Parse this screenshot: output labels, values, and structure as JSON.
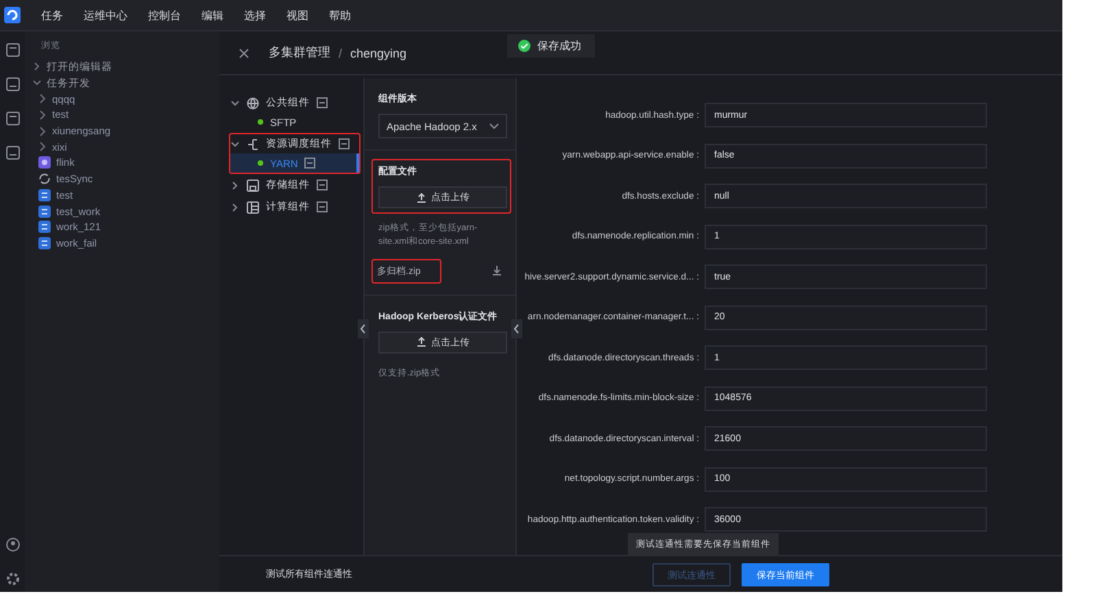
{
  "menu": [
    "任务",
    "运维中心",
    "控制台",
    "编辑",
    "选择",
    "视图",
    "帮助"
  ],
  "sidebar": {
    "heading": "浏览",
    "items": [
      {
        "label": "打开的编辑器",
        "expanded": false
      },
      {
        "label": "任务开发",
        "expanded": true,
        "children": [
          {
            "label": "qqqq",
            "kind": "folder"
          },
          {
            "label": "test",
            "kind": "folder"
          },
          {
            "label": "xiunengsang",
            "kind": "folder"
          },
          {
            "label": "xixi",
            "kind": "folder"
          },
          {
            "label": "flink",
            "kind": "flink"
          },
          {
            "label": "tesSync",
            "kind": "sync"
          },
          {
            "label": "test",
            "kind": "sql"
          },
          {
            "label": "test_work",
            "kind": "sql"
          },
          {
            "label": "work_121",
            "kind": "sql"
          },
          {
            "label": "work_fail",
            "kind": "sql"
          }
        ]
      }
    ]
  },
  "toast": {
    "text": "保存成功"
  },
  "breadcrumb": [
    "多集群管理",
    "chengying"
  ],
  "breadcrumb_separator": "/",
  "components": [
    {
      "label": "公共组件",
      "kind": "globe",
      "expanded": true,
      "children": [
        {
          "label": "SFTP",
          "selected": false
        }
      ]
    },
    {
      "label": "资源调度组件",
      "kind": "scheduler",
      "expanded": true,
      "highlighted": true,
      "children": [
        {
          "label": "YARN",
          "selected": true
        }
      ]
    },
    {
      "label": "存储组件",
      "kind": "storage",
      "expanded": false
    },
    {
      "label": "计算组件",
      "kind": "compute",
      "expanded": false
    }
  ],
  "config": {
    "version_label": "组件版本",
    "version": "Apache Hadoop 2.x",
    "sections": [
      {
        "title": "配置文件",
        "upload": "点击上传",
        "note": "zip格式，至少包括yarn-site.xml和core-site.xml",
        "file": {
          "name": "多归档.zip",
          "highlighted": true
        },
        "highlighted": true
      },
      {
        "title": "Hadoop Kerberos认证文件",
        "upload": "点击上传",
        "note": "仅支持.zip格式"
      }
    ]
  },
  "form": [
    {
      "label": "hadoop.util.hash.type :",
      "value": "murmur"
    },
    {
      "label": "yarn.webapp.api-service.enable :",
      "value": "false"
    },
    {
      "label": "dfs.hosts.exclude :",
      "value": "null"
    },
    {
      "label": "dfs.namenode.replication.min :",
      "value": "1"
    },
    {
      "label": "hive.server2.support.dynamic.service.d... :",
      "value": "true"
    },
    {
      "label": "arn.nodemanager.container-manager.t... :",
      "value": "20"
    },
    {
      "label": "dfs.datanode.directoryscan.threads :",
      "value": "1"
    },
    {
      "label": "dfs.namenode.fs-limits.min-block-size :",
      "value": "1048576"
    },
    {
      "label": "dfs.datanode.directoryscan.interval :",
      "value": "21600"
    },
    {
      "label": "net.topology.script.number.args :",
      "value": "100"
    },
    {
      "label": "hadoop.http.authentication.token.validity :",
      "value": "36000"
    }
  ],
  "footer": {
    "label": "测试所有组件连通性",
    "tooltip": "测试连通性需要先保存当前组件",
    "buttons": [
      {
        "label": "测试连通性",
        "kind": "secondary",
        "disabled": true
      },
      {
        "label": "保存当前组件",
        "kind": "primary",
        "disabled": false
      }
    ]
  }
}
